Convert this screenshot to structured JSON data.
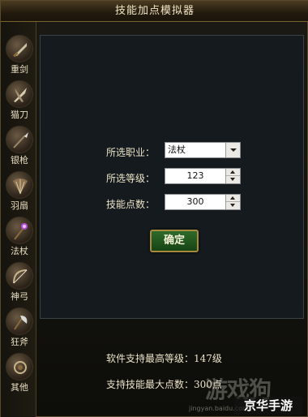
{
  "window": {
    "title": "技能加点模拟器"
  },
  "sidebar": {
    "items": [
      {
        "label": "重剑",
        "icon": "greatsword-icon"
      },
      {
        "label": "猫刀",
        "icon": "dual-blades-icon"
      },
      {
        "label": "银枪",
        "icon": "spear-icon"
      },
      {
        "label": "羽扇",
        "icon": "feather-fan-icon"
      },
      {
        "label": "法杖",
        "icon": "staff-icon"
      },
      {
        "label": "神弓",
        "icon": "bow-icon"
      },
      {
        "label": "狂斧",
        "icon": "axe-icon"
      },
      {
        "label": "其他",
        "icon": "misc-weapon-icon"
      }
    ]
  },
  "form": {
    "class_label": "所选职业：",
    "class_value": "法杖",
    "level_label": "所选等级：",
    "level_value": "123",
    "points_label": "技能点数：",
    "points_value": "300",
    "confirm_label": "确定"
  },
  "info": {
    "max_level": "软件支持最高等级：147级",
    "max_points": "支持技能最大点数：300点"
  },
  "watermark": {
    "logo_text": "游戏狗",
    "url": "jingyan.baidu.com",
    "badge": "京华手游"
  },
  "colors": {
    "title_bar": "#4a3c22",
    "panel_bg": "#141a1d",
    "confirm_green": "#2f6b2a",
    "gold_border": "#a88a3e"
  }
}
